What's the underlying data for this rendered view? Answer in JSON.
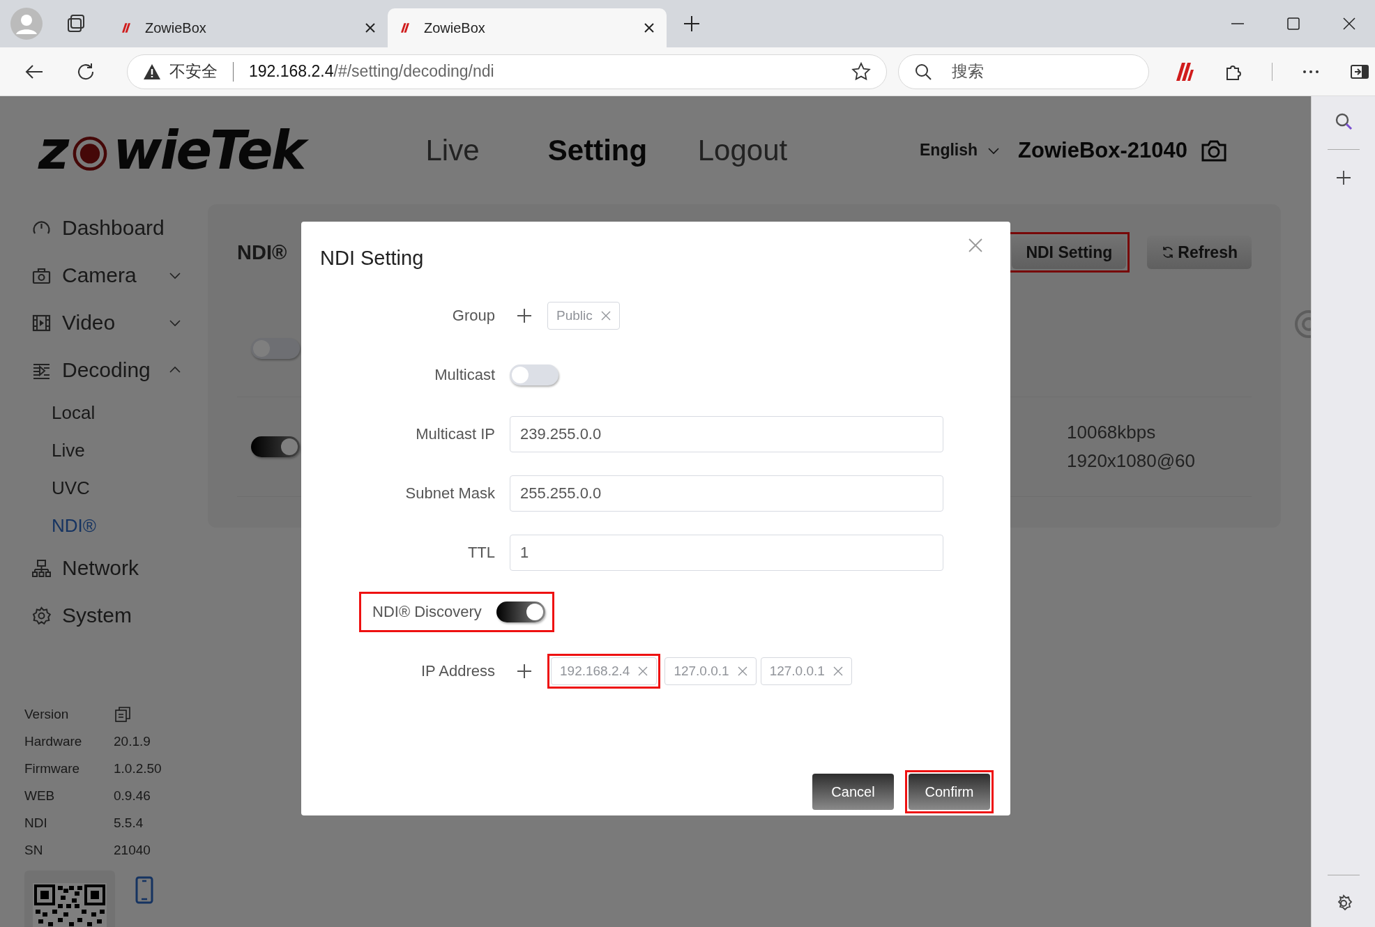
{
  "browser": {
    "tabs": [
      {
        "title": "ZowieBox",
        "selected": false
      },
      {
        "title": "ZowieBox",
        "selected": true
      }
    ],
    "address": {
      "warning": "不安全",
      "host": "192.168.2.4",
      "path": "/#/setting/decoding/ndi"
    },
    "search": {
      "placeholder": "搜索"
    }
  },
  "header": {
    "logo": {
      "lead": "z",
      "tail": "wieTek"
    },
    "nav": [
      {
        "label": "Live",
        "selected": false
      },
      {
        "label": "Setting",
        "selected": true
      },
      {
        "label": "Logout",
        "selected": false
      }
    ],
    "language": "English",
    "device": "ZowieBox-21040"
  },
  "sidebar": {
    "items": [
      {
        "label": "Dashboard",
        "selected": false
      },
      {
        "label": "Camera",
        "selected": false,
        "expanded": false
      },
      {
        "label": "Video",
        "selected": false,
        "expanded": false
      },
      {
        "label": "Decoding",
        "selected": false,
        "expanded": true,
        "children": [
          {
            "label": "Local",
            "selected": false
          },
          {
            "label": "Live",
            "selected": false
          },
          {
            "label": "UVC",
            "selected": false
          },
          {
            "label": "NDI®",
            "selected": true
          }
        ]
      },
      {
        "label": "Network",
        "selected": false
      },
      {
        "label": "System",
        "selected": false
      }
    ],
    "version": {
      "title": "Version",
      "rows": [
        {
          "label": "Hardware",
          "value": "20.1.9"
        },
        {
          "label": "Firmware",
          "value": "1.0.2.50"
        },
        {
          "label": "WEB",
          "value": "0.9.46"
        },
        {
          "label": "NDI",
          "value": "5.5.4"
        },
        {
          "label": "SN",
          "value": "21040"
        }
      ]
    }
  },
  "content": {
    "title": "NDI®",
    "buttons": [
      {
        "label": "NDI Setting",
        "kind": "plain",
        "highlighted": true
      },
      {
        "label": "Refresh",
        "kind": "refresh",
        "highlighted": false
      }
    ],
    "rows": [
      {
        "on": false
      },
      {
        "on": true,
        "bitrate": "10068kbps",
        "resolution": "1920x1080@60"
      }
    ]
  },
  "dialog": {
    "title": "NDI Setting",
    "fields": [
      {
        "kind": "tags",
        "label": "Group",
        "highlighted": false,
        "tags": [
          {
            "text": "Public",
            "highlighted": false
          }
        ]
      },
      {
        "kind": "switch",
        "label": "Multicast",
        "on": false,
        "highlighted": false
      },
      {
        "kind": "input",
        "label": "Multicast IP",
        "value": "239.255.0.0",
        "highlighted": false
      },
      {
        "kind": "input",
        "label": "Subnet Mask",
        "value": "255.255.0.0",
        "highlighted": false
      },
      {
        "kind": "input",
        "label": "TTL",
        "value": "1",
        "highlighted": false
      },
      {
        "kind": "switch",
        "label": "NDI® Discovery",
        "on": true,
        "highlighted": true
      },
      {
        "kind": "tags",
        "label": "IP Address",
        "highlighted": false,
        "tags": [
          {
            "text": "192.168.2.4",
            "highlighted": true
          },
          {
            "text": "127.0.0.1",
            "highlighted": false
          },
          {
            "text": "127.0.0.1",
            "highlighted": false
          }
        ]
      }
    ],
    "buttons": [
      {
        "label": "Cancel",
        "highlighted": false
      },
      {
        "label": "Confirm",
        "highlighted": true
      }
    ]
  }
}
